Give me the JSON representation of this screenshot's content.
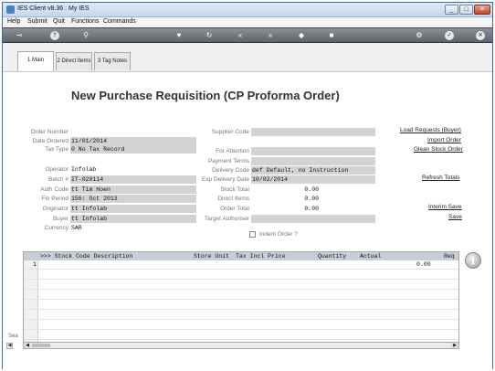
{
  "window": {
    "title": "IES Client v8.36 : My IES",
    "minimize": "_",
    "maximize": "□",
    "close": "✕"
  },
  "menu": [
    "Help",
    "Submit",
    "Quit",
    "Functions",
    "Commands"
  ],
  "toolbar_icons": [
    "key-icon",
    "help-icon",
    "search-icon",
    "heart-icon",
    "refresh-icon",
    "rewind-icon",
    "fast-forward-icon",
    "stop-icon",
    "settings-icon",
    "check-icon",
    "close-icon"
  ],
  "tabs": [
    {
      "label": "1 Main"
    },
    {
      "label": "2 Direct Items"
    },
    {
      "label": "3 Tag Notes"
    }
  ],
  "page_title": "New Purchase Requisition (CP Proforma Order)",
  "left_fields": [
    {
      "label": "Order Number",
      "value": ""
    },
    {
      "label": "Date Ordered",
      "value": "11/01/2014"
    },
    {
      "label": "Tax Type",
      "value": "0 No Tax Record"
    },
    {
      "label": "Operator",
      "value": "Infolab"
    },
    {
      "label": "Batch #",
      "value": "IT-020114"
    },
    {
      "label": "Auth Code",
      "value": "tt Tim Hoen"
    },
    {
      "label": "Fin Period",
      "value": "156: Oct 2013"
    },
    {
      "label": "Originator",
      "value": "tt Infolab"
    },
    {
      "label": "Buyer",
      "value": "tt Infolab"
    },
    {
      "label": "Currency",
      "value": "SAR"
    }
  ],
  "right_fields": [
    {
      "label": "Supplier Code",
      "value": ""
    },
    {
      "label": "For Attention",
      "value": ""
    },
    {
      "label": "Payment Terms",
      "value": ""
    },
    {
      "label": "Delivery Code",
      "value": "def Default, no Instruction"
    },
    {
      "label": "Exp Delivery Date",
      "value": "10/02/2014"
    },
    {
      "label": "Stock Total",
      "value": "0.00"
    },
    {
      "label": "Direct Items",
      "value": "0.00"
    },
    {
      "label": "Order Total",
      "value": "0.00"
    },
    {
      "label": "Target Authoriser",
      "value": ""
    }
  ],
  "indent_order_label": "Indent Order ?",
  "links": {
    "load_requests": "Load Requests (Buyer)",
    "import_order": "Import Order",
    "glean_stock": "Glean Stock Order",
    "refresh_totals": "Refresh Totals",
    "interim_save": "Interim Save",
    "save": "Save"
  },
  "grid": {
    "columns": [
      ">>> Stock Code Description",
      "Store Unit",
      "Tax Incl Price",
      "Quantity",
      "Actual",
      "Req"
    ],
    "rows": [
      {
        "num": "1",
        "value": "0.00"
      }
    ]
  },
  "side_text": "Sea",
  "info_icon": "i"
}
